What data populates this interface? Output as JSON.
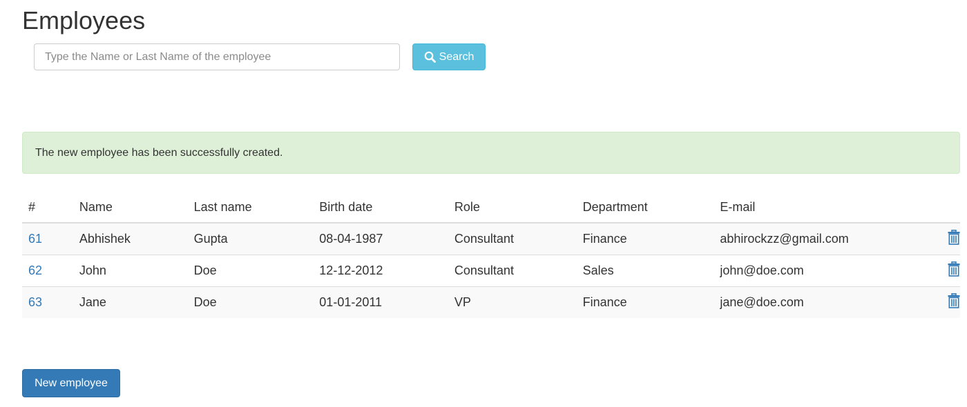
{
  "page": {
    "title": "Employees"
  },
  "search": {
    "placeholder": "Type the Name or Last Name of the employee",
    "value": "",
    "button_label": "Search",
    "button_icon": "search-icon"
  },
  "alert": {
    "message": "The new employee has been successfully created."
  },
  "table": {
    "headers": {
      "id": "#",
      "name": "Name",
      "last_name": "Last name",
      "birth_date": "Birth date",
      "role": "Role",
      "department": "Department",
      "email": "E-mail"
    },
    "rows": [
      {
        "id": "61",
        "name": "Abhishek",
        "last_name": "Gupta",
        "birth_date": "08-04-1987",
        "role": "Consultant",
        "department": "Finance",
        "email": "abhirockzz@gmail.com"
      },
      {
        "id": "62",
        "name": "John",
        "last_name": "Doe",
        "birth_date": "12-12-2012",
        "role": "Consultant",
        "department": "Sales",
        "email": "john@doe.com"
      },
      {
        "id": "63",
        "name": "Jane",
        "last_name": "Doe",
        "birth_date": "01-01-2011",
        "role": "VP",
        "department": "Finance",
        "email": "jane@doe.com"
      }
    ],
    "row_action_icon": "trash-icon"
  },
  "footer": {
    "new_button_label": "New employee"
  },
  "colors": {
    "info_button": "#5bc0de",
    "primary_button": "#337ab7",
    "link": "#337ab7",
    "success_alert_bg": "#dff0d8"
  }
}
